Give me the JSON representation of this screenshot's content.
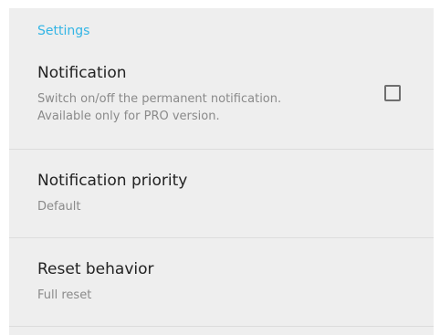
{
  "settings": {
    "section_title": "Settings",
    "notification": {
      "title": "Notification",
      "summary_line1": "Switch on/off the permanent notification.",
      "summary_line2": "Available only for PRO version.",
      "checked": false
    },
    "priority": {
      "title": "Notification priority",
      "summary": "Default"
    },
    "reset": {
      "title": "Reset behavior",
      "summary": "Full reset"
    }
  }
}
